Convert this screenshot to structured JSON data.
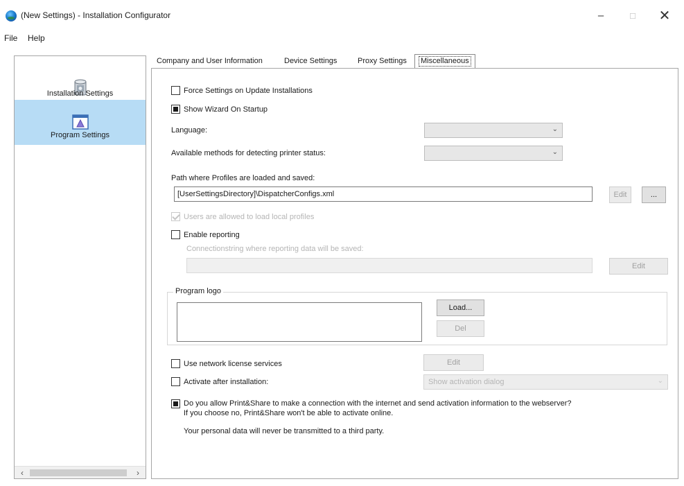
{
  "window": {
    "title": "(New Settings) - Installation Configurator",
    "minimize": "–",
    "maximize": "□",
    "close": "✕"
  },
  "menu": {
    "file": "File",
    "help": "Help"
  },
  "nav": {
    "items": [
      {
        "label": "Installation Settings",
        "icon": "installer-icon"
      },
      {
        "label": "Program Settings",
        "icon": "program-icon",
        "selected": true
      }
    ],
    "scroll_left": "‹",
    "scroll_right": "›"
  },
  "tabs": [
    {
      "label": "Company and User Information"
    },
    {
      "label": "Device Settings"
    },
    {
      "label": "Proxy Settings"
    },
    {
      "label": "Miscellaneous",
      "active": true
    }
  ],
  "misc": {
    "force_settings": {
      "label": "Force Settings on Update Installations",
      "checked": false
    },
    "show_wizard": {
      "label": "Show Wizard On Startup",
      "checked": true
    },
    "language_label": "Language:",
    "language_value": "",
    "printer_status_label": "Available methods for detecting printer status:",
    "printer_status_value": "",
    "profiles_path_label": "Path where Profiles are loaded and saved:",
    "profiles_path_value": "[UserSettingsDirectory]\\DispatcherConfigs.xml",
    "profiles_edit_button": "Edit",
    "profiles_browse_button": "...",
    "load_local_profiles": {
      "label": "Users are allowed to load local profiles",
      "checked": true
    },
    "enable_reporting": {
      "label": "Enable reporting",
      "checked": false
    },
    "reporting_path_label": "Connectionstring where reporting data will be saved:",
    "reporting_path_value": "",
    "reporting_edit_button": "Edit",
    "program_logo_label": "Program logo",
    "load_button": "Load...",
    "logo_delete_button": "Del",
    "network_license": {
      "label": "Use network license services",
      "checked": false
    },
    "network_license_edit_button": "Edit",
    "activate_after_install": {
      "label": "Activate after installation:",
      "checked": false
    },
    "activation_mode_value": "Show activation dialog",
    "allow_connection": {
      "checked": true,
      "line1": "Do you allow Print&Share to make a connection with the internet and send activation  information to the webserver?",
      "line2": "If you choose no, Print&Share won't be able to activate online."
    },
    "privacy_note": "Your personal data will never be transmitted to a third party."
  }
}
